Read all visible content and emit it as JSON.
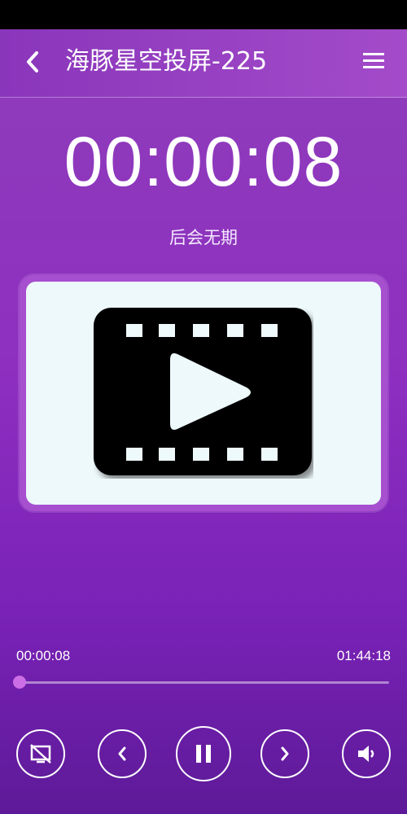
{
  "header": {
    "title": "海豚星空投屏-225",
    "back_icon": "chevron-left-icon",
    "menu_icon": "hamburger-menu-icon"
  },
  "player": {
    "timer": "00:00:08",
    "track_title": "后会无期",
    "elapsed": "00:00:08",
    "duration": "01:44:18",
    "progress_fraction": 0.0013,
    "cover_icon": "video-film-play-icon"
  },
  "controls": {
    "items": [
      {
        "icon": "screen-cast-off-icon"
      },
      {
        "icon": "chevron-left-icon"
      },
      {
        "icon": "pause-icon"
      },
      {
        "icon": "chevron-right-icon"
      },
      {
        "icon": "volume-icon"
      }
    ]
  },
  "colors": {
    "accent": "#cc6fe6",
    "background": "#8e2fc0",
    "cover_bg": "#eef9fb"
  }
}
